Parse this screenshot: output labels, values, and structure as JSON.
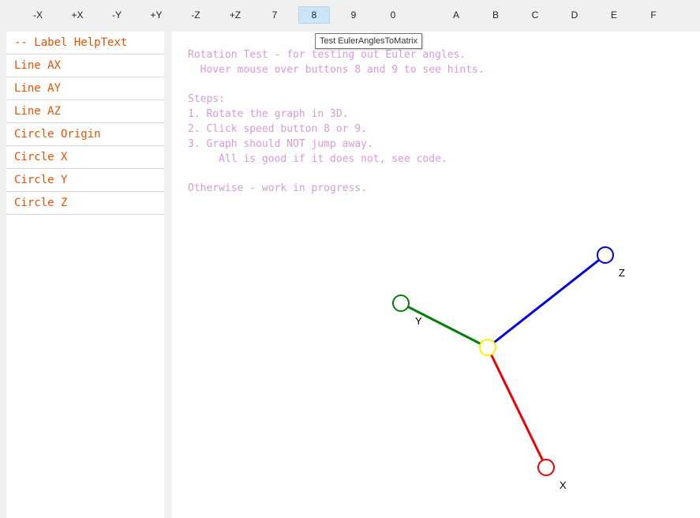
{
  "toolbar": {
    "buttons": [
      "-X",
      "+X",
      "-Y",
      "+Y",
      "-Z",
      "+Z",
      "7",
      "8",
      "9",
      "0",
      "A",
      "B",
      "C",
      "D",
      "E",
      "F"
    ],
    "active_button": "8",
    "tooltip": "Test EulerAnglesToMatrix"
  },
  "sidebar": {
    "items": [
      "-- Label HelpText",
      "Line AX",
      "Line AY",
      "Line AZ",
      "Circle Origin",
      "Circle X",
      "Circle Y",
      "Circle Z"
    ]
  },
  "help": {
    "lines": [
      "Rotation Test - for testing out Euler angles.",
      "  Hover mouse over buttons 8 and 9 to see hints.",
      "",
      "Steps:",
      "1. Rotate the graph in 3D.",
      "2. Click speed button 8 or 9.",
      "3. Graph should NOT jump away.",
      "     All is good if it does not, see code.",
      "",
      "Otherwise - work in progress."
    ]
  },
  "graph": {
    "labels": {
      "x": "X",
      "y": "Y",
      "z": "Z"
    },
    "colors": {
      "x": "#ee0000",
      "y": "#008000",
      "z": "#0000dd",
      "origin": "#ffee00"
    }
  }
}
